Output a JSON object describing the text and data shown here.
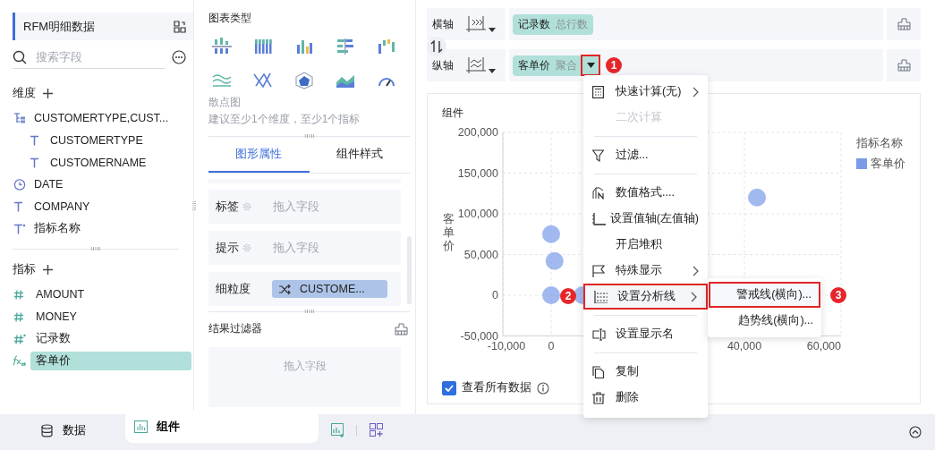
{
  "data_panel": {
    "title": "RFM明细数据",
    "search": {
      "placeholder": "搜索字段"
    },
    "dimensions": {
      "label": "维度",
      "items": [
        {
          "label": "CUSTOMERTYPE,CUST...",
          "kind": "hierarchy",
          "children": [
            {
              "label": "CUSTOMERTYPE",
              "kind": "text"
            },
            {
              "label": "CUSTOMERNAME",
              "kind": "text"
            }
          ]
        },
        {
          "label": "DATE",
          "kind": "date"
        },
        {
          "label": "COMPANY",
          "kind": "text"
        },
        {
          "label": "指标名称",
          "kind": "text-star"
        }
      ]
    },
    "measures": {
      "label": "指标",
      "items": [
        {
          "label": "AMOUNT",
          "kind": "number",
          "selected": false
        },
        {
          "label": "MONEY",
          "kind": "number",
          "selected": false
        },
        {
          "label": "记录数",
          "kind": "number-star",
          "selected": false
        },
        {
          "label": "客单价",
          "kind": "formula",
          "selected": true
        }
      ]
    }
  },
  "chart_types": {
    "title": "图表类型",
    "name": "散点图",
    "hint": "建议至少1个维度，至少1个指标"
  },
  "property_tabs": [
    {
      "label": "图形属性",
      "selected": true
    },
    {
      "label": "组件样式",
      "selected": false
    }
  ],
  "properties": [
    {
      "label": "标签",
      "kind": "drop",
      "placeholder": "拖入字段"
    },
    {
      "label": "提示",
      "kind": "drop",
      "placeholder": "拖入字段"
    },
    {
      "label": "细粒度",
      "kind": "field",
      "value": "CUSTOME..."
    }
  ],
  "result_filter": {
    "title": "结果过滤器",
    "placeholder": "拖入字段"
  },
  "axes": [
    {
      "label": "横轴",
      "field": "记录数",
      "agg": "总行数",
      "dropdown": false
    },
    {
      "label": "纵轴",
      "field": "客单价",
      "agg": "聚合",
      "dropdown": true,
      "step": "1"
    }
  ],
  "chart": {
    "title": "组件",
    "chart_data": {
      "type": "scatter",
      "grid": true,
      "ylabel": "客单价",
      "x": [
        0,
        700,
        0,
        6500,
        42600
      ],
      "series": [
        {
          "name": "客单价",
          "color": "#7b9be8",
          "values": [
            75000,
            42000,
            0,
            0,
            120000
          ]
        }
      ],
      "xlim": [
        -10000,
        60000
      ],
      "ylim": [
        -50000,
        200000
      ],
      "xticks": [
        {
          "value": -10000,
          "label": "-10,000"
        },
        {
          "value": 0,
          "label": "0"
        },
        {
          "value": 40000,
          "label": "40,000"
        },
        {
          "value": 60000,
          "label": "60,000"
        }
      ],
      "yticks": [
        {
          "value": -50000,
          "label": "-50,000"
        },
        {
          "value": 0,
          "label": "0"
        },
        {
          "value": 50000,
          "label": "50,000"
        },
        {
          "value": 100000,
          "label": "100,000"
        },
        {
          "value": 150000,
          "label": "150,000"
        },
        {
          "value": 200000,
          "label": "200,000"
        }
      ]
    },
    "legend": {
      "title": "指标名称"
    },
    "show_all": {
      "label": "查看所有数据",
      "checked": true
    }
  },
  "context_menu": {
    "items": [
      {
        "kind": "item",
        "label": "快速计算(无)",
        "submenu": true,
        "disabled": false,
        "selected": false
      },
      {
        "kind": "item",
        "label": "二次计算",
        "submenu": false,
        "disabled": true,
        "selected": false
      },
      {
        "kind": "divider"
      },
      {
        "kind": "item",
        "label": "过滤...",
        "submenu": false,
        "disabled": false,
        "selected": false
      },
      {
        "kind": "divider"
      },
      {
        "kind": "item",
        "label": "数值格式....",
        "submenu": false,
        "disabled": false,
        "selected": false
      },
      {
        "kind": "item",
        "label": "设置值轴(左值轴)",
        "submenu": false,
        "disabled": false,
        "selected": false
      },
      {
        "kind": "item",
        "label": "开启堆积",
        "submenu": false,
        "disabled": false,
        "selected": false
      },
      {
        "kind": "item",
        "label": "特殊显示",
        "submenu": true,
        "disabled": false,
        "selected": false
      },
      {
        "kind": "item",
        "label": "设置分析线",
        "submenu": true,
        "disabled": false,
        "selected": true,
        "step": "2"
      },
      {
        "kind": "divider"
      },
      {
        "kind": "item",
        "label": "设置显示名",
        "submenu": false,
        "disabled": false,
        "selected": false
      },
      {
        "kind": "divider"
      },
      {
        "kind": "item",
        "label": "复制",
        "submenu": false,
        "disabled": false,
        "selected": false
      },
      {
        "kind": "item",
        "label": "删除",
        "submenu": false,
        "disabled": false,
        "selected": false
      }
    ]
  },
  "submenu": {
    "items": [
      {
        "label": "警戒线(横向)...",
        "selected": true,
        "step": "3"
      },
      {
        "label": "趋势线(横向)...",
        "selected": false
      }
    ]
  },
  "bottom_tabs": [
    {
      "label": "数据",
      "selected": false
    },
    {
      "label": "组件",
      "selected": true
    }
  ]
}
